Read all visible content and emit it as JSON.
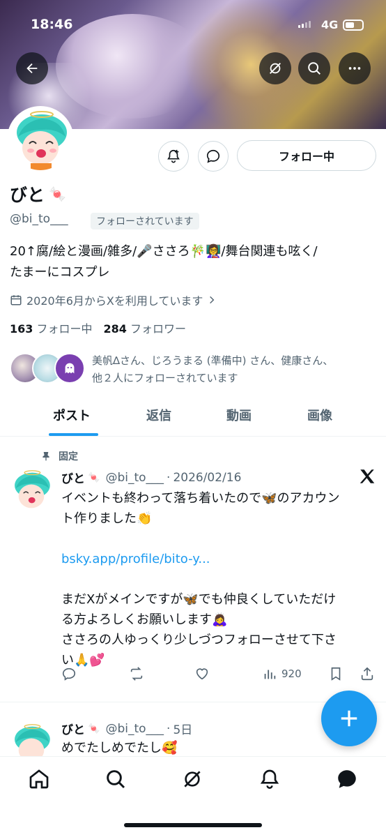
{
  "status": {
    "time": "18:46",
    "network": "4G"
  },
  "profile": {
    "name": "びと",
    "handle": "@bi_to___",
    "follows_you": "フォローされています",
    "bio_line1": "20↑腐/絵と漫画/雑多/🎤ささろ🎋👩‍🏫/舞台関連も呟く/",
    "bio_line2": "たまーにコスプレ",
    "joined": "2020年6月からXを利用しています",
    "following_count": "163",
    "following_label": "フォロー中",
    "followers_count": "284",
    "followers_label": "フォロワー",
    "mutuals_line1": "美帆∆さん、じろうまる (準備中) さん、健康さん、",
    "mutuals_line2": "他２人にフォローされています",
    "follow_button": "フォロー中"
  },
  "tabs": [
    {
      "label": "ポスト",
      "active": true
    },
    {
      "label": "返信",
      "active": false
    },
    {
      "label": "動画",
      "active": false
    },
    {
      "label": "画像",
      "active": false
    }
  ],
  "pinned_label": "固定",
  "posts": [
    {
      "name": "びと",
      "handle": "@bi_to___",
      "date": "2026/02/16",
      "line1": "イベントも終わって落ち着いたので🦋のアカウン",
      "line2": "ト作りました👏",
      "link": "bsky.app/profile/bito-y...",
      "line3": "まだXがメインですが🦋でも仲良くしていただけ",
      "line4": "る方よろしくお願いします🙇‍♀️",
      "line5": "ささろの人ゆっくり少しづつフォローさせて下さ",
      "line6": "い🙏💕",
      "views": "920"
    },
    {
      "name": "びと",
      "handle": "@bi_to___",
      "date": "5日",
      "line1": "めでたしめでたし🥰"
    }
  ],
  "colors": {
    "accent": "#1d9bf0",
    "text": "#0f1419",
    "muted": "#536471"
  }
}
